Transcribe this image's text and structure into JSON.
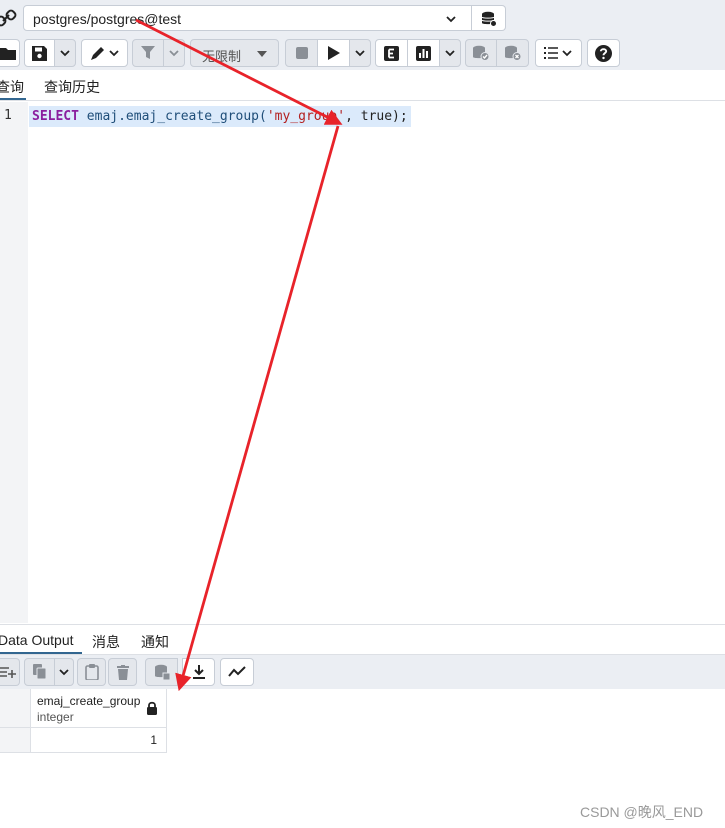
{
  "connection": {
    "value": "postgres/postgres@test",
    "icon": "connection-link-icon"
  },
  "toolbar": {
    "limit_label": "无限制",
    "icons": [
      "open-folder-icon",
      "save-icon",
      "chevron-down-icon",
      "edit-pencil-icon",
      "filter-icon",
      "stop-icon",
      "play-icon",
      "explain-icon",
      "explain-analyze-icon",
      "commit-icon",
      "rollback-icon",
      "macros-icon",
      "help-icon"
    ]
  },
  "editor_tabs": {
    "query": "查询",
    "history": "查询历史"
  },
  "editor": {
    "line_number": "1",
    "sql_keyword": "SELECT",
    "sql_function": "emaj.emaj_create_group(",
    "sql_string": "'my_group'",
    "sql_tail": ", true);"
  },
  "results_tabs": {
    "data_output": "Data Output",
    "messages": "消息",
    "notifications": "通知"
  },
  "grid": {
    "columns": [
      {
        "name": "emaj_create_group",
        "type": "integer"
      }
    ],
    "rows": [
      [
        "1"
      ]
    ]
  },
  "watermark": "CSDN @晚风_END",
  "colors": {
    "toolbar_bg": "#ebeef3",
    "accent": "#326690",
    "annotation_arrow": "#e8232a",
    "selection": "#dbeafb"
  }
}
